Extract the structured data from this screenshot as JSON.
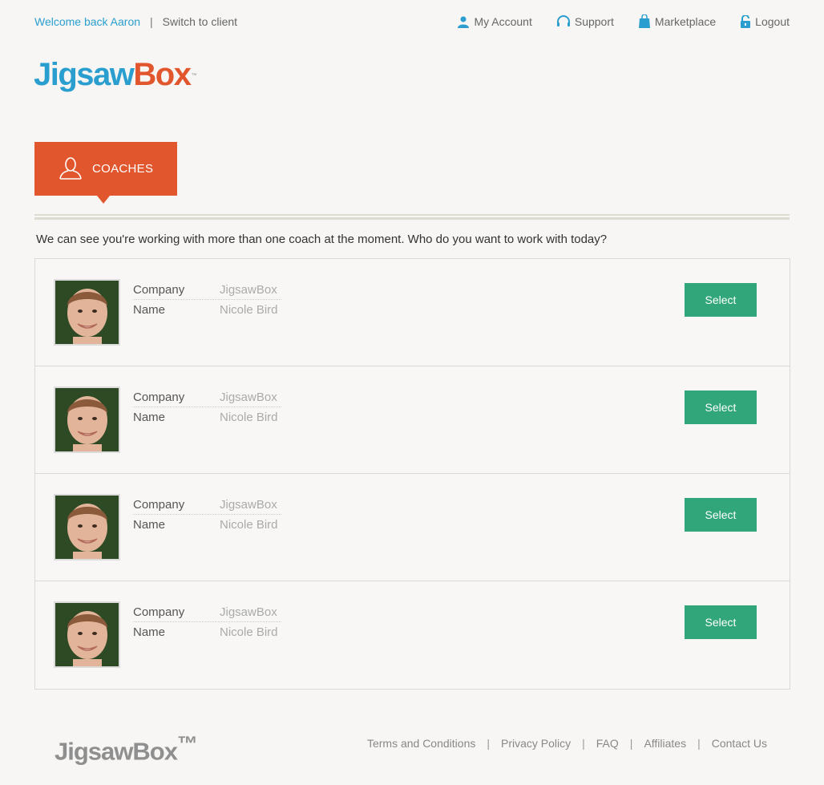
{
  "topbar": {
    "welcome": "Welcome back Aaron",
    "separator": "|",
    "switch_client": "Switch to client",
    "nav": [
      {
        "icon": "user-icon",
        "label": "My Account"
      },
      {
        "icon": "headset-icon",
        "label": "Support"
      },
      {
        "icon": "shopping-bag-icon",
        "label": "Marketplace"
      },
      {
        "icon": "lock-icon",
        "label": "Logout"
      }
    ]
  },
  "logo": {
    "part1": "Jigsaw",
    "part2": "Box",
    "tm": "™"
  },
  "tab": {
    "icon": "person-outline-icon",
    "label": "COACHES"
  },
  "intro": "We can see you're working with more than one coach at the moment. Who do you want to work with today?",
  "coaches": [
    {
      "company_label": "Company",
      "company": "JigsawBox",
      "name_label": "Name",
      "name": "Nicole Bird",
      "button": "Select"
    },
    {
      "company_label": "Company",
      "company": "JigsawBox",
      "name_label": "Name",
      "name": "Nicole Bird",
      "button": "Select"
    },
    {
      "company_label": "Company",
      "company": "JigsawBox",
      "name_label": "Name",
      "name": "Nicole Bird",
      "button": "Select"
    },
    {
      "company_label": "Company",
      "company": "JigsawBox",
      "name_label": "Name",
      "name": "Nicole Bird",
      "button": "Select"
    }
  ],
  "footer": {
    "logo": "JigsawBox",
    "tm": "™",
    "links": [
      "Terms and Conditions",
      "Privacy Policy",
      "FAQ",
      "Affiliates",
      "Contact Us"
    ],
    "separator": "|"
  },
  "colors": {
    "accent_blue": "#2a9fcf",
    "accent_orange": "#e2562d",
    "button_green": "#30a67a",
    "background": "#f7f6f4"
  }
}
